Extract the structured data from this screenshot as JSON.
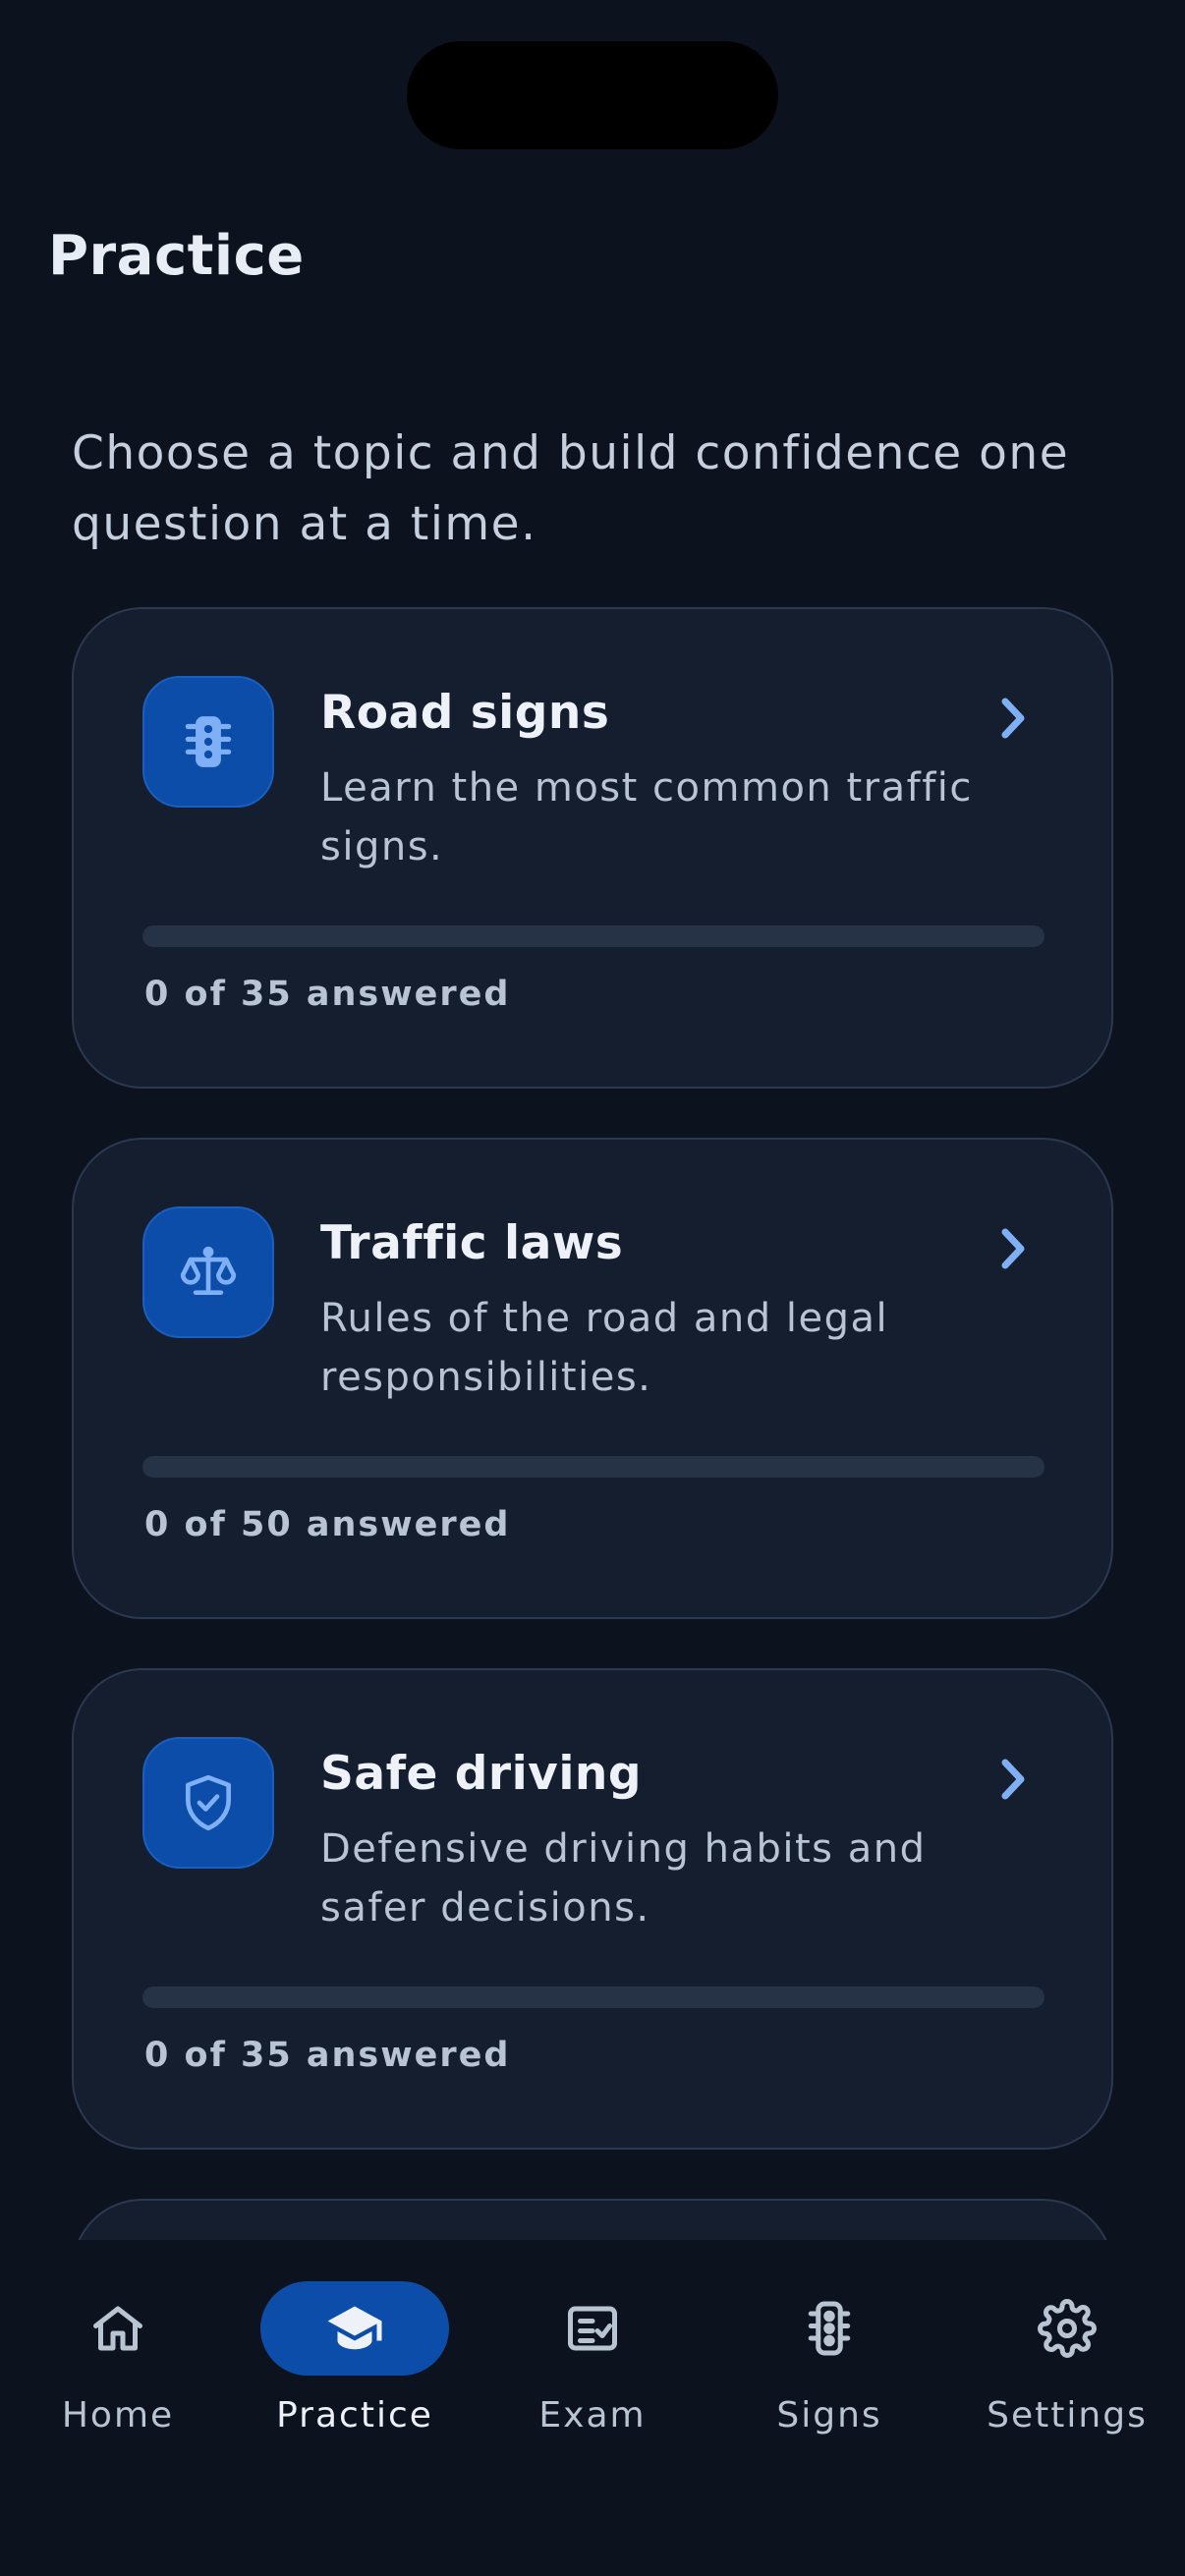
{
  "header": {
    "title": "Practice"
  },
  "intro": "Choose a topic and build confidence one question at a time.",
  "colors": {
    "accent": "#0b4da8",
    "chevron": "#7fb0f5",
    "background": "#0d131e",
    "card": "#151e2e"
  },
  "topics": [
    {
      "title": "Road signs",
      "description": "Learn the most common traffic signs.",
      "progress_text": "0 of 35 answered",
      "progress": 0,
      "icon": "traffic-light-icon"
    },
    {
      "title": "Traffic laws",
      "description": "Rules of the road and legal responsibilities.",
      "progress_text": "0 of 50 answered",
      "progress": 0,
      "icon": "scales-icon"
    },
    {
      "title": "Safe driving",
      "description": "Defensive driving habits and safer decisions.",
      "progress_text": "0 of 35 answered",
      "progress": 0,
      "icon": "shield-check-icon"
    }
  ],
  "tabs": [
    {
      "label": "Home",
      "icon": "home-icon",
      "active": false
    },
    {
      "label": "Practice",
      "icon": "graduation-cap-icon",
      "active": true
    },
    {
      "label": "Exam",
      "icon": "exam-checklist-icon",
      "active": false
    },
    {
      "label": "Signs",
      "icon": "traffic-light-icon",
      "active": false
    },
    {
      "label": "Settings",
      "icon": "gear-icon",
      "active": false
    }
  ]
}
